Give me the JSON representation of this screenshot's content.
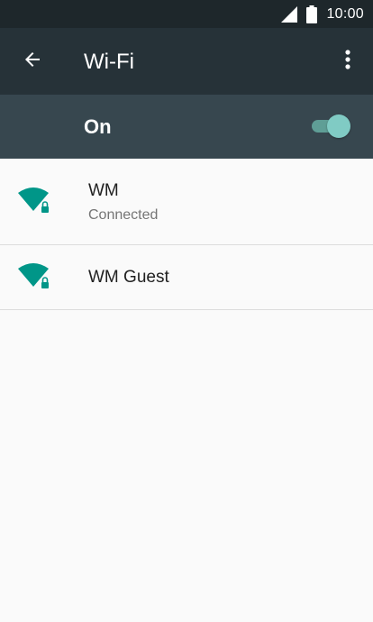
{
  "status_bar": {
    "time": "10:00",
    "icons": [
      "cell-signal-icon",
      "battery-icon"
    ]
  },
  "app_bar": {
    "title": "Wi-Fi",
    "back_icon": "arrow-back-icon",
    "menu_icon": "more-vert-icon"
  },
  "master_switch": {
    "label": "On",
    "state": true
  },
  "networks": [
    {
      "name": "WM",
      "status": "Connected",
      "icon": "wifi-lock-icon"
    },
    {
      "name": "WM Guest",
      "status": "",
      "icon": "wifi-lock-icon"
    }
  ],
  "colors": {
    "status_bar_bg": "#1e272b",
    "app_bar_bg": "#263238",
    "switch_bar_bg": "#37474f",
    "accent": "#009688",
    "toggle_thumb": "#80cbc4",
    "background": "#fafafa"
  }
}
